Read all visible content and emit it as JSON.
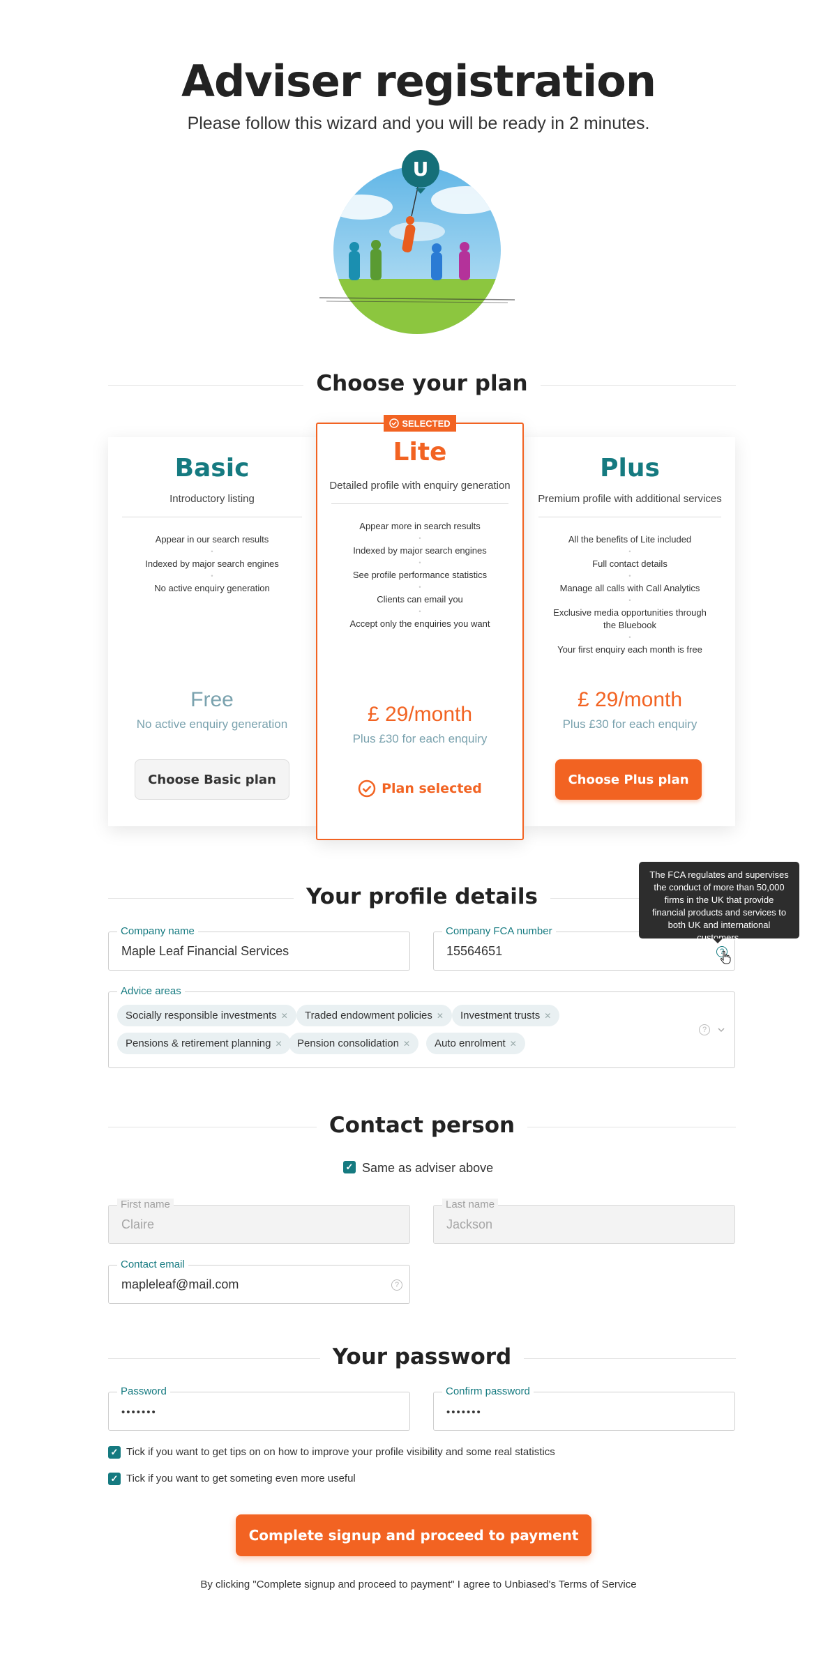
{
  "header": {
    "title": "Adviser registration",
    "subtitle": "Please follow this wizard and you will be ready in 2 minutes.",
    "logo_letter": "U"
  },
  "plan_section": {
    "heading": "Choose your plan",
    "plans": [
      {
        "name": "Basic",
        "tagline": "Introductory listing",
        "features": [
          "Appear in our search results",
          "Indexed by major search engines",
          "No active enquiry generation"
        ],
        "price": "Free",
        "price_note": "No active enquiry generation",
        "button": "Choose Basic plan"
      },
      {
        "name": "Lite",
        "badge": "SELECTED",
        "tagline": "Detailed profile with enquiry generation",
        "features": [
          "Appear more in search results",
          "Indexed by major search engines",
          "See profile performance statistics",
          "Clients can email you",
          "Accept only the enquiries you want"
        ],
        "price": "£ 29/month",
        "price_note": "Plus £30 for each enquiry",
        "status": "Plan selected"
      },
      {
        "name": "Plus",
        "tagline": "Premium profile with additional services",
        "features": [
          "All the benefits of Lite included",
          "Full contact details",
          "Manage all calls with Call Analytics",
          "Exclusive media opportunities through the Bluebook",
          "Your first enquiry each month is free"
        ],
        "price": "£ 29/month",
        "price_note": "Plus £30 for each enquiry",
        "button": "Choose Plus plan"
      }
    ]
  },
  "profile_section": {
    "heading": "Your profile details",
    "company_name": {
      "label": "Company name",
      "value": "Maple Leaf Financial Services"
    },
    "fca_number": {
      "label": "Company FCA number",
      "value": "15564651"
    },
    "tooltip": "The FCA regulates and supervises the conduct of more than 50,000 firms in the UK that provide financial products and services to both UK and international customers.",
    "advice_areas": {
      "label": "Advice areas",
      "tags": [
        "Socially responsible investments",
        "Traded endowment policies",
        "Investment trusts",
        "Pensions & retirement planning",
        "Pension consolidation",
        "Auto enrolment"
      ]
    }
  },
  "contact_section": {
    "heading": "Contact person",
    "same_as_label": "Same as adviser above",
    "first_name": {
      "label": "First name",
      "value": "Claire"
    },
    "last_name": {
      "label": "Last name",
      "value": "Jackson"
    },
    "email": {
      "label": "Contact email",
      "value": "mapleleaf@mail.com"
    }
  },
  "password_section": {
    "heading": "Your password",
    "password": {
      "label": "Password",
      "value": "•••••••"
    },
    "confirm": {
      "label": "Confirm password",
      "value": "•••••••"
    },
    "opt_tips": "Tick if you want to get tips on on how to improve your profile visibility and some real statistics",
    "opt_useful": "Tick if you want to get someting even more useful"
  },
  "footer": {
    "cta": "Complete signup and proceed to payment",
    "terms": "By clicking \"Complete signup and proceed to payment\" I agree to Unbiased's Terms of Service"
  },
  "colors": {
    "accent": "#f26322",
    "teal": "#157a80",
    "basic_heading": "#157a80",
    "muted_price": "#7aa2ae"
  }
}
